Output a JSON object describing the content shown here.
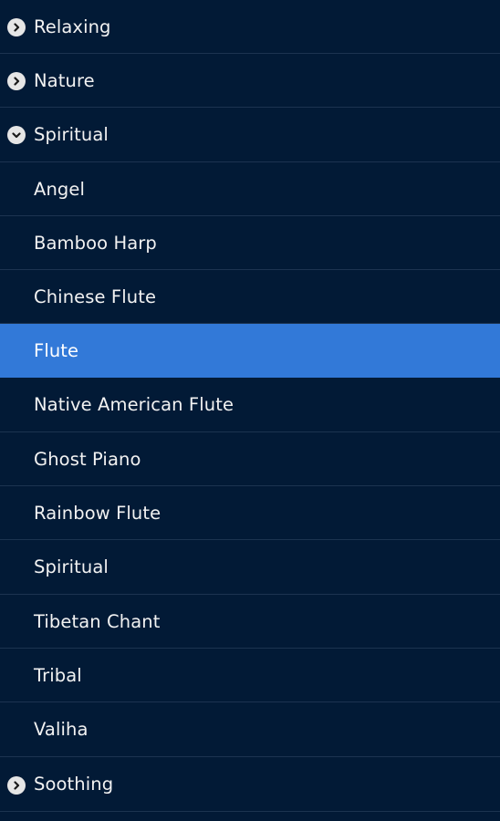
{
  "categories": [
    {
      "label": "Relaxing",
      "state": "collapsed",
      "icon": "chevron-right-icon"
    },
    {
      "label": "Nature",
      "state": "collapsed",
      "icon": "chevron-right-icon"
    },
    {
      "label": "Spiritual",
      "state": "expanded",
      "icon": "chevron-down-icon"
    },
    {
      "label": "Soothing",
      "state": "collapsed",
      "icon": "chevron-right-icon"
    }
  ],
  "spiritual_items": [
    {
      "label": "Angel"
    },
    {
      "label": "Bamboo Harp"
    },
    {
      "label": "Chinese Flute"
    },
    {
      "label": "Flute",
      "selected": true
    },
    {
      "label": "Native American Flute"
    },
    {
      "label": "Ghost Piano"
    },
    {
      "label": "Rainbow Flute"
    },
    {
      "label": "Spiritual"
    },
    {
      "label": "Tibetan Chant"
    },
    {
      "label": "Tribal"
    },
    {
      "label": "Valiha"
    }
  ],
  "colors": {
    "background": "#021a36",
    "divider": "#1c3350",
    "selected": "#3279d8",
    "text": "#f2f2f2",
    "chevron_circle": "#e6e6e6"
  }
}
